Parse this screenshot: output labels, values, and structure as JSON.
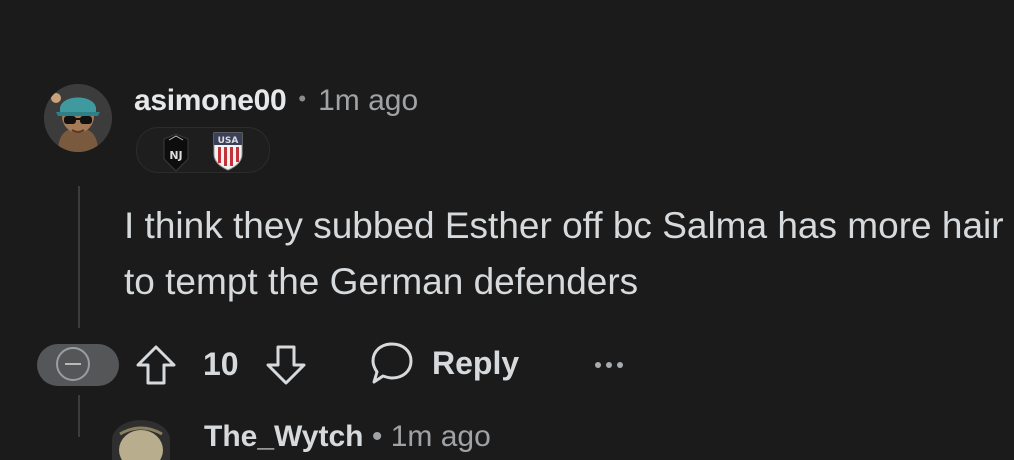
{
  "comment": {
    "username": "asimone00",
    "separator": "•",
    "timestamp": "1m ago",
    "flair": [
      {
        "icon": "ny-gotham-crest-icon",
        "text": "NJ"
      },
      {
        "icon": "usa-crest-icon",
        "text": "USA"
      }
    ],
    "body": "I think they subbed Esther off bc Salma has more hair to tempt the German defenders",
    "score": "10",
    "reply_label": "Reply",
    "icons": {
      "collapse": "minus-circle-icon",
      "upvote": "upvote-arrow-icon",
      "downvote": "downvote-arrow-icon",
      "reply": "speech-bubble-icon",
      "more": "ellipsis-icon"
    }
  },
  "next_comment": {
    "username": "The_Wytch",
    "separator": "•",
    "timestamp": "1m ago"
  },
  "colors": {
    "background": "#1b1b1b",
    "text": "#d7dadc",
    "muted": "#a0a3a6",
    "thread_line": "#3c3c3c"
  }
}
